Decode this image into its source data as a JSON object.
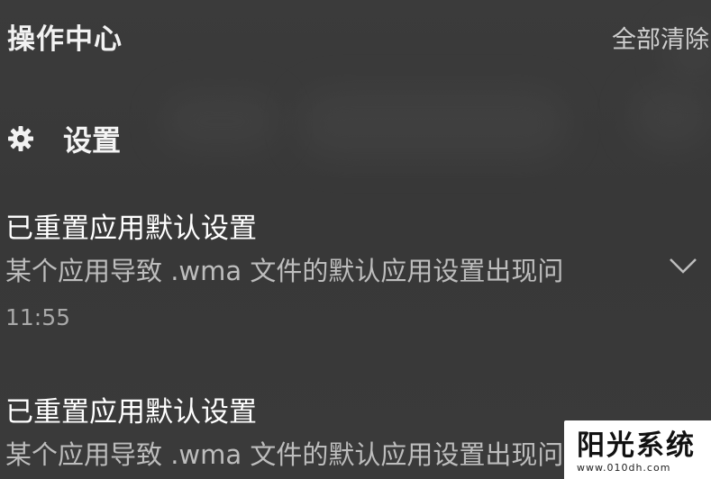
{
  "header": {
    "title": "操作中心",
    "clear_all_label": "全部清除"
  },
  "group": {
    "icon": "gear-icon",
    "title": "设置"
  },
  "notifications": [
    {
      "title": "已重置应用默认设置",
      "body": "某个应用导致 .wma 文件的默认应用设置出现问",
      "time": "11:55",
      "expand_icon": "chevron-down-icon"
    },
    {
      "title": "已重置应用默认设置",
      "body": "某个应用导致 .wma 文件的默认应用设置出现问"
    }
  ],
  "watermark": {
    "name": "阳光系统",
    "url": "www.010dh.com"
  },
  "colors": {
    "background": "#3a3a3a",
    "primary_text": "#ffffff",
    "secondary_text": "#bdbdbd"
  }
}
